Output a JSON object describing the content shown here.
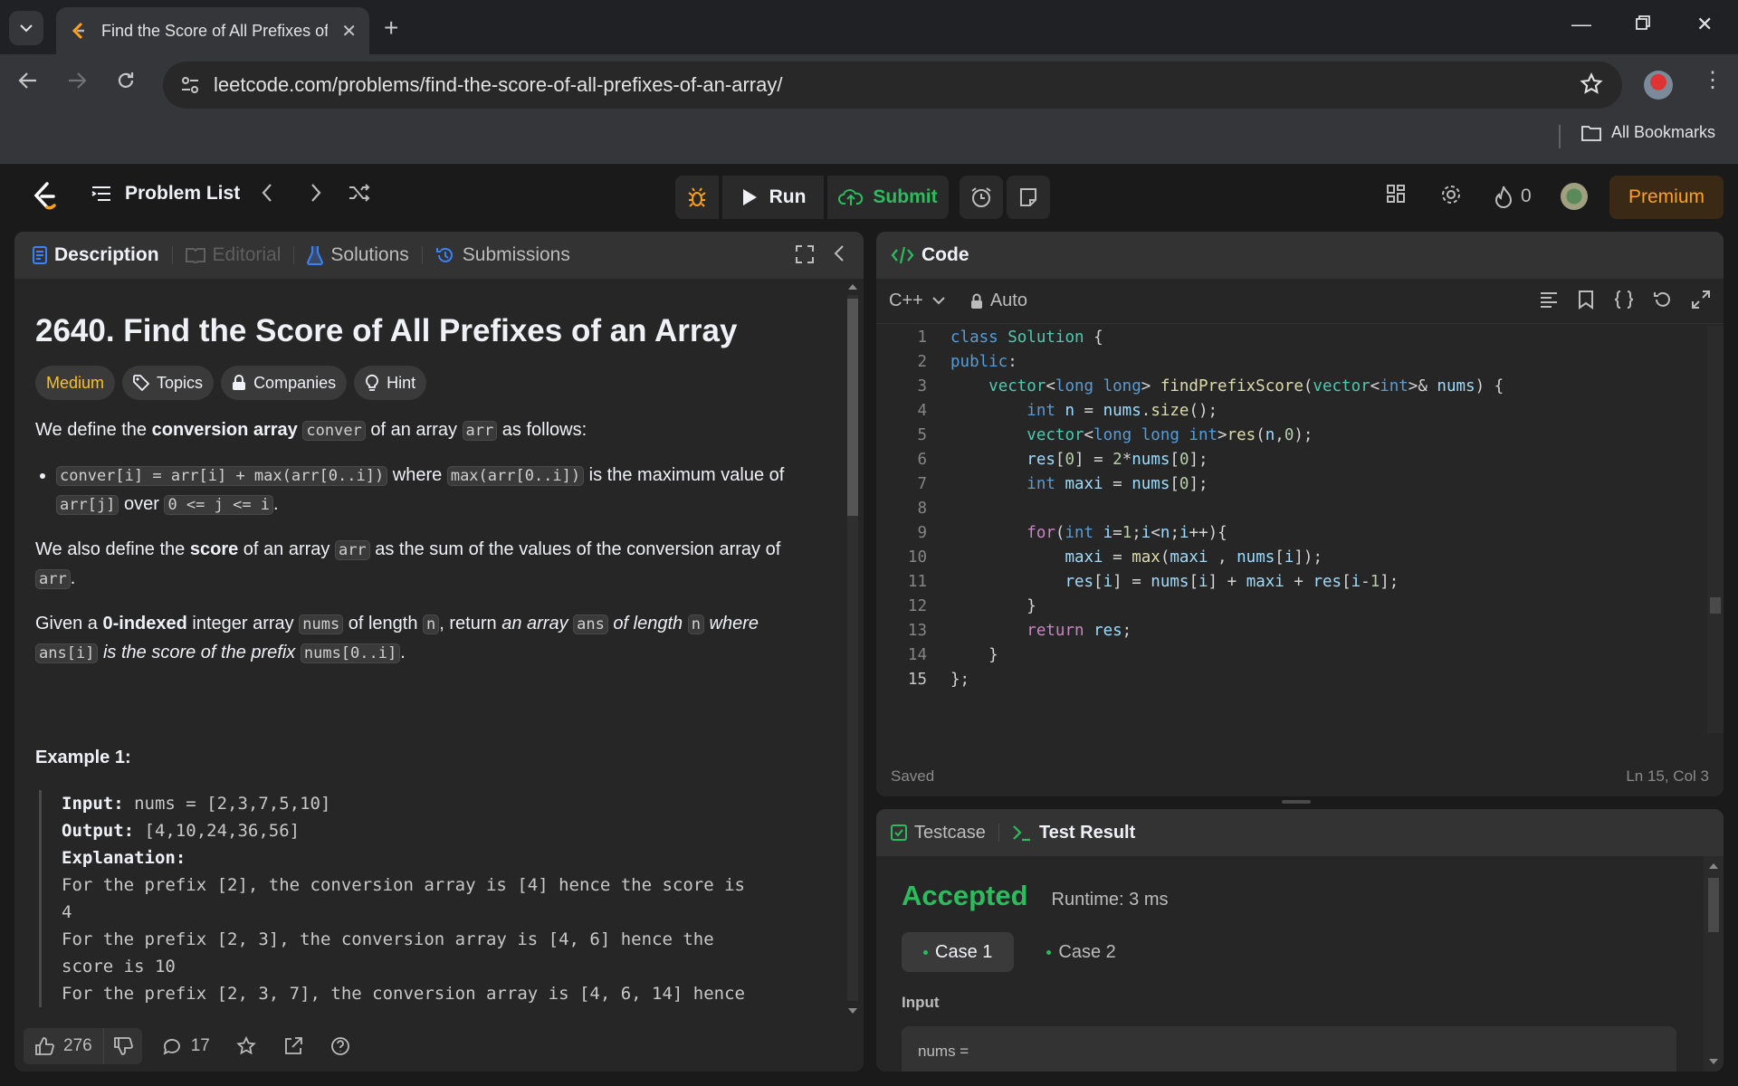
{
  "browser": {
    "tab_title": "Find the Score of All Prefixes of",
    "url": "leetcode.com/problems/find-the-score-of-all-prefixes-of-an-array/",
    "bookmarks_label": "All Bookmarks"
  },
  "header": {
    "problem_list_label": "Problem List",
    "run_label": "Run",
    "submit_label": "Submit",
    "streak_count": "0",
    "premium_label": "Premium"
  },
  "left_tabs": {
    "description": "Description",
    "editorial": "Editorial",
    "solutions": "Solutions",
    "submissions": "Submissions"
  },
  "problem": {
    "title": "2640. Find the Score of All Prefixes of an Array",
    "difficulty": "Medium",
    "topics_label": "Topics",
    "companies_label": "Companies",
    "hint_label": "Hint",
    "p1": {
      "t1": "We define the ",
      "b1": "conversion array",
      "t2": " ",
      "c1": "conver",
      "t3": " of an array ",
      "c2": "arr",
      "t4": " as follows:"
    },
    "bullet": {
      "c1": "conver[i] = arr[i] + max(arr[0..i])",
      "t1": " where ",
      "c2": "max(arr[0..i])",
      "t2": " is the maximum value of ",
      "c3": "arr[j]",
      "t3": " over ",
      "c4": "0 <= j <= i",
      "t4": "."
    },
    "p2": {
      "t1": "We also define the ",
      "b1": "score",
      "t2": " of an array ",
      "c1": "arr",
      "t3": " as the sum of the values of the conversion array of ",
      "c2": "arr",
      "t4": "."
    },
    "p3": {
      "t1": "Given a ",
      "b1": "0-indexed",
      "t2": " integer array ",
      "c1": "nums",
      "t3": " of length ",
      "c2": "n",
      "t4": ", return ",
      "i1": "an array ",
      "c3": "ans",
      "i2": " of length ",
      "c4": "n",
      "i3": " where ",
      "c5": "ans[i]",
      "i4": " is the score of the prefix ",
      "c6": "nums[0..i]",
      "t5": "."
    },
    "example_title": "Example 1:",
    "example": {
      "input_label": "Input:",
      "input_value": " nums = [2,3,7,5,10]",
      "output_label": "Output:",
      "output_value": " [4,10,24,36,56]",
      "explanation_label": "Explanation:",
      "lines": [
        "For the prefix [2], the conversion array is [4] hence the score is",
        "4",
        "For the prefix [2, 3], the conversion array is [4, 6] hence the",
        "score is 10",
        "For the prefix [2, 3, 7], the conversion array is [4, 6, 14] hence"
      ]
    }
  },
  "footer": {
    "likes": "276",
    "comments": "17"
  },
  "code_panel": {
    "title": "Code",
    "language": "C++",
    "mode": "Auto",
    "status": "Saved",
    "cursor": "Ln 15, Col 3",
    "line_numbers": [
      "1",
      "2",
      "3",
      "4",
      "5",
      "6",
      "7",
      "8",
      "9",
      "10",
      "11",
      "12",
      "13",
      "14",
      "15"
    ]
  },
  "test_panel": {
    "testcase_label": "Testcase",
    "result_label": "Test Result",
    "status": "Accepted",
    "runtime": "Runtime: 3 ms",
    "case1": "Case 1",
    "case2": "Case 2",
    "input_label": "Input",
    "input_value": "nums ="
  },
  "colors": {
    "accent_green": "#2cbb5d",
    "medium": "#ffc01e",
    "premium": "#ffa116"
  }
}
